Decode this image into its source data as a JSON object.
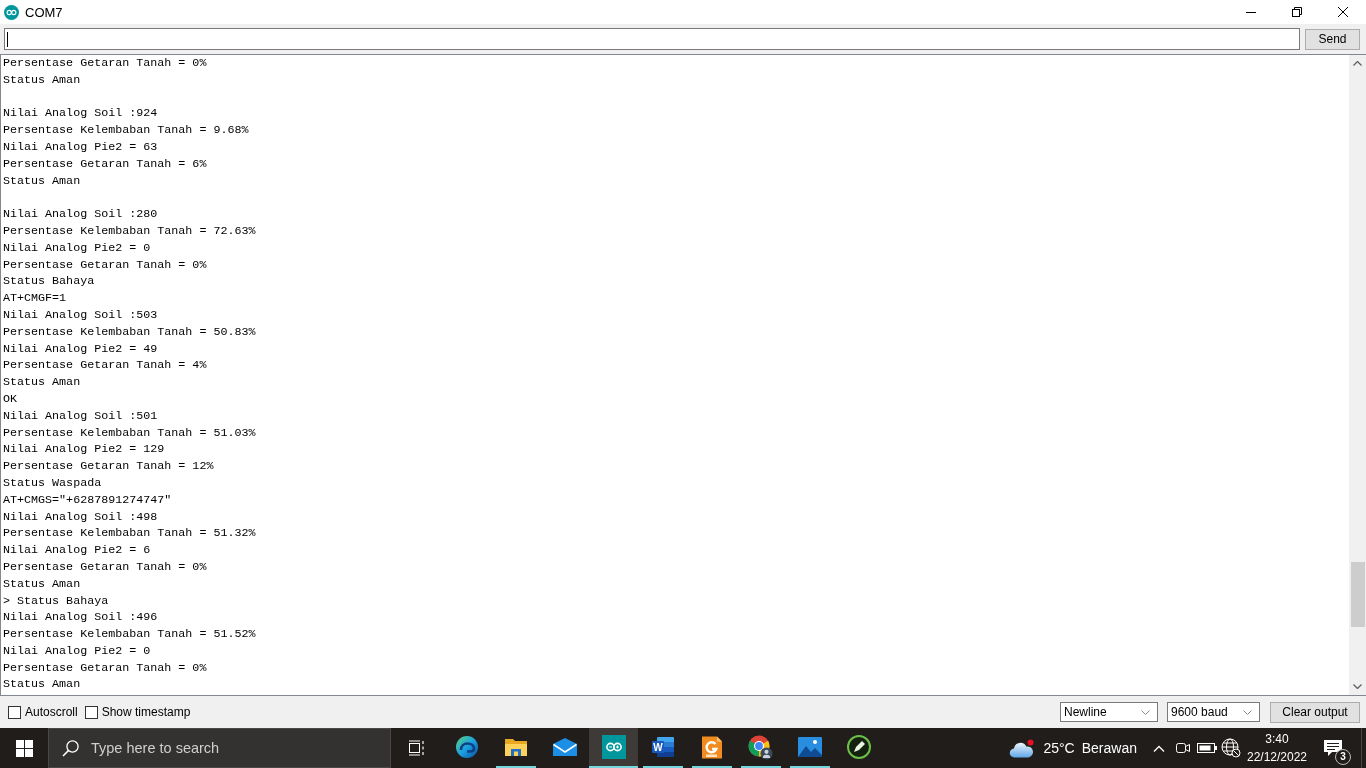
{
  "window": {
    "title": "COM7"
  },
  "send_bar": {
    "input": {
      "focused": true
    },
    "send_button": "Send"
  },
  "output": {
    "lines": [
      {
        "kind": "text",
        "text": "Persentase Getaran Tanah = 0%"
      },
      {
        "kind": "text",
        "text": "Status Aman"
      },
      {
        "kind": "blank"
      },
      {
        "kind": "text",
        "text": "Nilai Analog Soil :924"
      },
      {
        "kind": "text",
        "text": "Persentase Kelembaban Tanah = 9.68%"
      },
      {
        "kind": "text",
        "text": "Nilai Analog Pie2 = 63"
      },
      {
        "kind": "text",
        "text": "Persentase Getaran Tanah = 6%"
      },
      {
        "kind": "text",
        "text": "Status Aman"
      },
      {
        "kind": "blank"
      },
      {
        "kind": "text",
        "text": "Nilai Analog Soil :280"
      },
      {
        "kind": "text",
        "text": "Persentase Kelembaban Tanah = 72.63%"
      },
      {
        "kind": "text",
        "text": "Nilai Analog Pie2 = 0"
      },
      {
        "kind": "text",
        "text": "Persentase Getaran Tanah = 0%"
      },
      {
        "kind": "text",
        "text": "Status Bahaya"
      },
      {
        "kind": "text",
        "text": "AT+CMGF=1"
      },
      {
        "kind": "text",
        "text": "Nilai Analog Soil :503"
      },
      {
        "kind": "text",
        "text": "Persentase Kelembaban Tanah = 50.83%"
      },
      {
        "kind": "text",
        "text": "Nilai Analog Pie2 = 49"
      },
      {
        "kind": "text",
        "text": "Persentase Getaran Tanah = 4%"
      },
      {
        "kind": "text",
        "text": "Status Aman"
      },
      {
        "kind": "text",
        "text": "OK"
      },
      {
        "kind": "text",
        "text": "Nilai Analog Soil :501"
      },
      {
        "kind": "text",
        "text": "Persentase Kelembaban Tanah = 51.03%"
      },
      {
        "kind": "text",
        "text": "Nilai Analog Pie2 = 129"
      },
      {
        "kind": "text",
        "text": "Persentase Getaran Tanah = 12%"
      },
      {
        "kind": "text",
        "text": "Status Waspada"
      },
      {
        "kind": "text",
        "text": "AT+CMGS=\"+6287891274747\""
      },
      {
        "kind": "text",
        "text": "Nilai Analog Soil :498"
      },
      {
        "kind": "text",
        "text": "Persentase Kelembaban Tanah = 51.32%"
      },
      {
        "kind": "text",
        "text": "Nilai Analog Pie2 = 6"
      },
      {
        "kind": "text",
        "text": "Persentase Getaran Tanah = 0%"
      },
      {
        "kind": "text",
        "text": "Status Aman"
      },
      {
        "kind": "text",
        "text": "> Status Bahaya"
      },
      {
        "kind": "text",
        "text": "Nilai Analog Soil :496"
      },
      {
        "kind": "text",
        "text": "Persentase Kelembaban Tanah = 51.52%"
      },
      {
        "kind": "text",
        "text": "Nilai Analog Pie2 = 0"
      },
      {
        "kind": "text",
        "text": "Persentase Getaran Tanah = 0%"
      },
      {
        "kind": "text",
        "text": "Status Aman"
      }
    ]
  },
  "controls": {
    "autoscroll": {
      "label": "Autoscroll",
      "checked": false
    },
    "show_timestamp": {
      "label": "Show timestamp",
      "checked": false
    },
    "line_ending": {
      "value": "Newline"
    },
    "baud_rate": {
      "value": "9600 baud"
    },
    "clear_button": "Clear output"
  },
  "taskbar": {
    "search": {
      "placeholder": "Type here to search"
    },
    "apps": [
      {
        "kind": "swirl",
        "running": false,
        "selected": false
      },
      {
        "kind": "folder",
        "running": true,
        "selected": false
      },
      {
        "kind": "envelope",
        "running": false,
        "selected": false
      },
      {
        "kind": "infinity",
        "running": true,
        "selected": true
      },
      {
        "kind": "document",
        "logo_text": "W",
        "running": true,
        "selected": false
      },
      {
        "kind": "page",
        "running": true,
        "selected": false
      },
      {
        "kind": "browser",
        "running": true,
        "selected": false
      },
      {
        "kind": "landscape",
        "running": true,
        "selected": false
      },
      {
        "kind": "pen",
        "running": false,
        "selected": false
      }
    ]
  },
  "tray": {
    "weather": {
      "temperature": "25°C",
      "condition": "Berawan"
    },
    "clock": {
      "time": "3:40",
      "date": "22/12/2022"
    },
    "notifications": {
      "count": "3"
    }
  }
}
